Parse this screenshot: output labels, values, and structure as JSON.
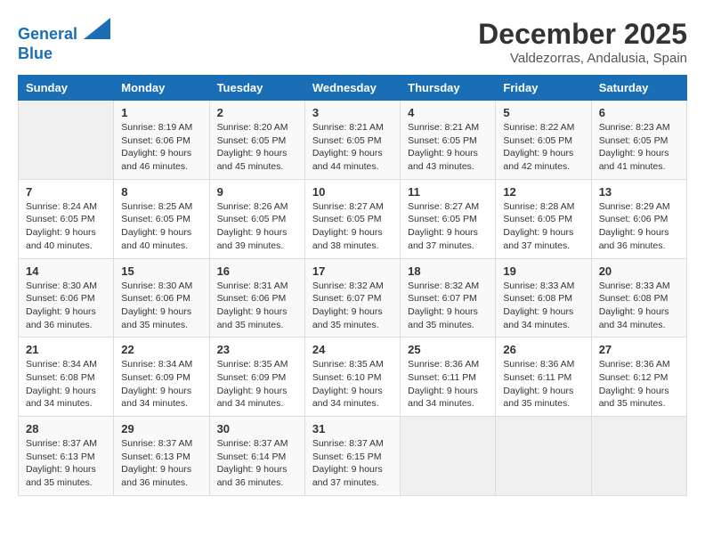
{
  "header": {
    "logo_line1": "General",
    "logo_line2": "Blue",
    "month_year": "December 2025",
    "location": "Valdezorras, Andalusia, Spain"
  },
  "days_of_week": [
    "Sunday",
    "Monday",
    "Tuesday",
    "Wednesday",
    "Thursday",
    "Friday",
    "Saturday"
  ],
  "weeks": [
    [
      {
        "day": "",
        "content": ""
      },
      {
        "day": "1",
        "content": "Sunrise: 8:19 AM\nSunset: 6:06 PM\nDaylight: 9 hours\nand 46 minutes."
      },
      {
        "day": "2",
        "content": "Sunrise: 8:20 AM\nSunset: 6:05 PM\nDaylight: 9 hours\nand 45 minutes."
      },
      {
        "day": "3",
        "content": "Sunrise: 8:21 AM\nSunset: 6:05 PM\nDaylight: 9 hours\nand 44 minutes."
      },
      {
        "day": "4",
        "content": "Sunrise: 8:21 AM\nSunset: 6:05 PM\nDaylight: 9 hours\nand 43 minutes."
      },
      {
        "day": "5",
        "content": "Sunrise: 8:22 AM\nSunset: 6:05 PM\nDaylight: 9 hours\nand 42 minutes."
      },
      {
        "day": "6",
        "content": "Sunrise: 8:23 AM\nSunset: 6:05 PM\nDaylight: 9 hours\nand 41 minutes."
      }
    ],
    [
      {
        "day": "7",
        "content": "Sunrise: 8:24 AM\nSunset: 6:05 PM\nDaylight: 9 hours\nand 40 minutes."
      },
      {
        "day": "8",
        "content": "Sunrise: 8:25 AM\nSunset: 6:05 PM\nDaylight: 9 hours\nand 40 minutes."
      },
      {
        "day": "9",
        "content": "Sunrise: 8:26 AM\nSunset: 6:05 PM\nDaylight: 9 hours\nand 39 minutes."
      },
      {
        "day": "10",
        "content": "Sunrise: 8:27 AM\nSunset: 6:05 PM\nDaylight: 9 hours\nand 38 minutes."
      },
      {
        "day": "11",
        "content": "Sunrise: 8:27 AM\nSunset: 6:05 PM\nDaylight: 9 hours\nand 37 minutes."
      },
      {
        "day": "12",
        "content": "Sunrise: 8:28 AM\nSunset: 6:05 PM\nDaylight: 9 hours\nand 37 minutes."
      },
      {
        "day": "13",
        "content": "Sunrise: 8:29 AM\nSunset: 6:06 PM\nDaylight: 9 hours\nand 36 minutes."
      }
    ],
    [
      {
        "day": "14",
        "content": "Sunrise: 8:30 AM\nSunset: 6:06 PM\nDaylight: 9 hours\nand 36 minutes."
      },
      {
        "day": "15",
        "content": "Sunrise: 8:30 AM\nSunset: 6:06 PM\nDaylight: 9 hours\nand 35 minutes."
      },
      {
        "day": "16",
        "content": "Sunrise: 8:31 AM\nSunset: 6:06 PM\nDaylight: 9 hours\nand 35 minutes."
      },
      {
        "day": "17",
        "content": "Sunrise: 8:32 AM\nSunset: 6:07 PM\nDaylight: 9 hours\nand 35 minutes."
      },
      {
        "day": "18",
        "content": "Sunrise: 8:32 AM\nSunset: 6:07 PM\nDaylight: 9 hours\nand 35 minutes."
      },
      {
        "day": "19",
        "content": "Sunrise: 8:33 AM\nSunset: 6:08 PM\nDaylight: 9 hours\nand 34 minutes."
      },
      {
        "day": "20",
        "content": "Sunrise: 8:33 AM\nSunset: 6:08 PM\nDaylight: 9 hours\nand 34 minutes."
      }
    ],
    [
      {
        "day": "21",
        "content": "Sunrise: 8:34 AM\nSunset: 6:08 PM\nDaylight: 9 hours\nand 34 minutes."
      },
      {
        "day": "22",
        "content": "Sunrise: 8:34 AM\nSunset: 6:09 PM\nDaylight: 9 hours\nand 34 minutes."
      },
      {
        "day": "23",
        "content": "Sunrise: 8:35 AM\nSunset: 6:09 PM\nDaylight: 9 hours\nand 34 minutes."
      },
      {
        "day": "24",
        "content": "Sunrise: 8:35 AM\nSunset: 6:10 PM\nDaylight: 9 hours\nand 34 minutes."
      },
      {
        "day": "25",
        "content": "Sunrise: 8:36 AM\nSunset: 6:11 PM\nDaylight: 9 hours\nand 34 minutes."
      },
      {
        "day": "26",
        "content": "Sunrise: 8:36 AM\nSunset: 6:11 PM\nDaylight: 9 hours\nand 35 minutes."
      },
      {
        "day": "27",
        "content": "Sunrise: 8:36 AM\nSunset: 6:12 PM\nDaylight: 9 hours\nand 35 minutes."
      }
    ],
    [
      {
        "day": "28",
        "content": "Sunrise: 8:37 AM\nSunset: 6:13 PM\nDaylight: 9 hours\nand 35 minutes."
      },
      {
        "day": "29",
        "content": "Sunrise: 8:37 AM\nSunset: 6:13 PM\nDaylight: 9 hours\nand 36 minutes."
      },
      {
        "day": "30",
        "content": "Sunrise: 8:37 AM\nSunset: 6:14 PM\nDaylight: 9 hours\nand 36 minutes."
      },
      {
        "day": "31",
        "content": "Sunrise: 8:37 AM\nSunset: 6:15 PM\nDaylight: 9 hours\nand 37 minutes."
      },
      {
        "day": "",
        "content": ""
      },
      {
        "day": "",
        "content": ""
      },
      {
        "day": "",
        "content": ""
      }
    ]
  ]
}
